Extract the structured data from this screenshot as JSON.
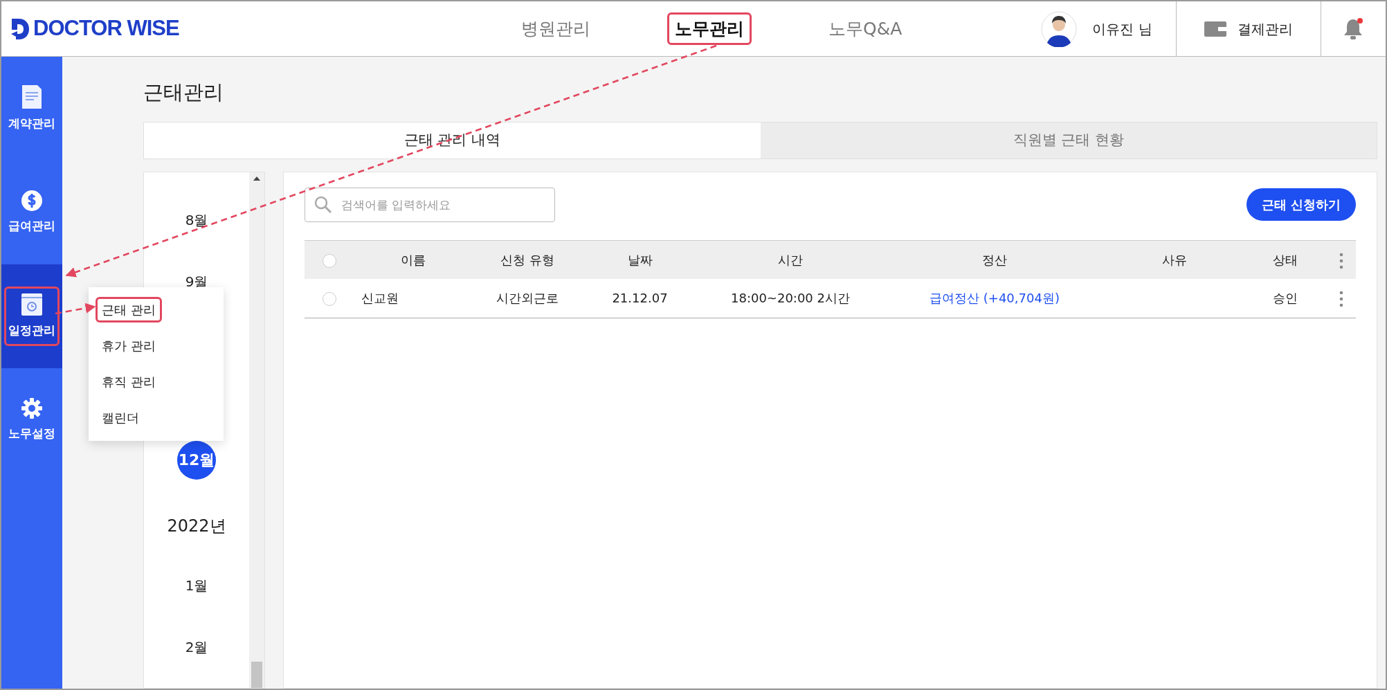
{
  "logo": {
    "text": "DOCTOR WISE"
  },
  "nav": [
    {
      "label": "병원관리",
      "selected": false,
      "highlighted": false
    },
    {
      "label": "노무관리",
      "selected": true,
      "highlighted": true
    },
    {
      "label": "노무Q&A",
      "selected": false,
      "highlighted": false
    }
  ],
  "user": {
    "name": "이유진 님"
  },
  "payment": {
    "label": "결제관리"
  },
  "notifications": {
    "unread": true
  },
  "sidebar": {
    "items": [
      {
        "label": "계약관리",
        "kind": "document",
        "selected": false,
        "highlighted": false
      },
      {
        "label": "급여관리",
        "kind": "dollar",
        "selected": false,
        "highlighted": false
      },
      {
        "label": "일정관리",
        "kind": "calendar",
        "selected": true,
        "highlighted": true
      },
      {
        "label": "노무설정",
        "kind": "gear",
        "selected": false,
        "highlighted": false
      }
    ]
  },
  "page_title": "근태관리",
  "tabs": [
    {
      "label": "근태 관리 내역",
      "selected": true
    },
    {
      "label": "직원별 근태 현황",
      "selected": false
    }
  ],
  "submenu": {
    "items": [
      {
        "label": "근태 관리",
        "highlighted": true
      },
      {
        "label": "휴가 관리",
        "highlighted": false
      },
      {
        "label": "휴직 관리",
        "highlighted": false
      },
      {
        "label": "캘린더",
        "highlighted": false
      }
    ]
  },
  "months": [
    {
      "label": "8월",
      "kind": "month",
      "selected": false
    },
    {
      "label": "9월",
      "kind": "month",
      "selected": false
    },
    {
      "label": "12월",
      "kind": "month",
      "selected": true
    },
    {
      "label": "2022년",
      "kind": "year",
      "selected": false
    },
    {
      "label": "1월",
      "kind": "month",
      "selected": false
    },
    {
      "label": "2월",
      "kind": "month",
      "selected": false
    }
  ],
  "search": {
    "placeholder": "검색어를 입력하세요"
  },
  "apply_button": "근태 신청하기",
  "table": {
    "select_all": {
      "checked": false
    },
    "columns": [
      "이름",
      "신청 유형",
      "날짜",
      "시간",
      "정산",
      "사유",
      "상태"
    ],
    "rows": [
      {
        "checked": false,
        "name": "신교원",
        "type": "시간외근로",
        "date": "21.12.07",
        "time": "18:00~20:00 2시간",
        "settlement": "급여정산 (+40,704원)",
        "status": "승인"
      }
    ]
  }
}
